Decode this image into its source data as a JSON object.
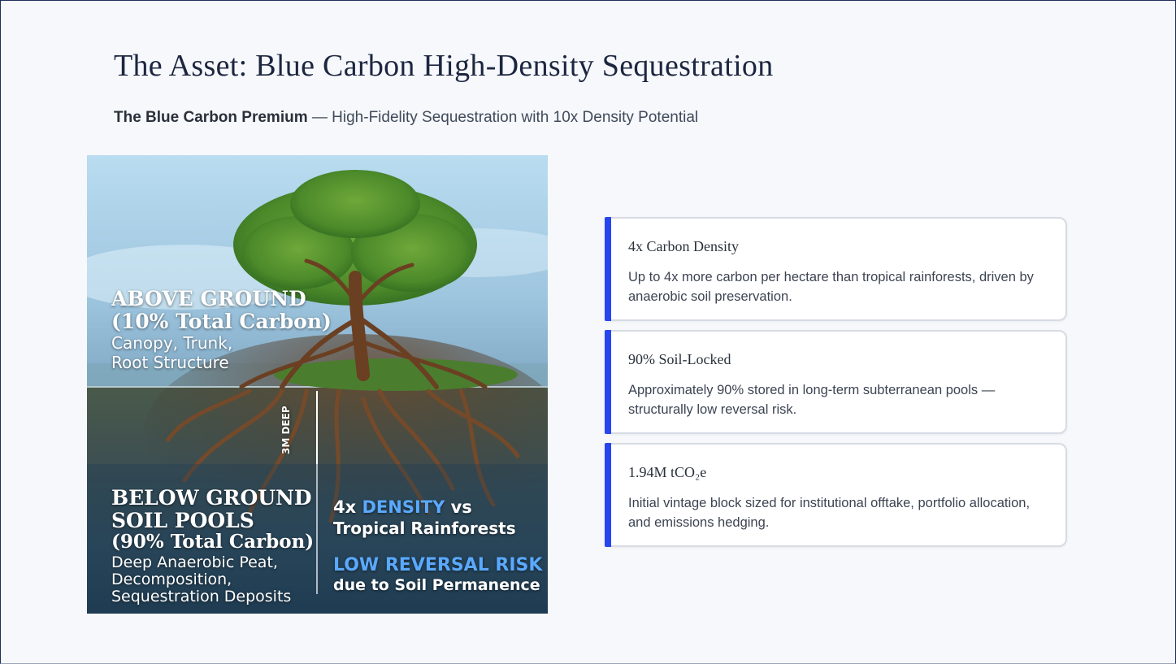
{
  "header": {
    "title": "The Asset: Blue Carbon High-Density Sequestration",
    "subtitle_bold": "The Blue Carbon Premium",
    "subtitle_rest": " — High-Fidelity Sequestration with 10x Density Potential"
  },
  "illustration": {
    "above_line1": "ABOVE GROUND",
    "above_line2": "(10% Total Carbon)",
    "above_line3": "Canopy, Trunk,",
    "above_line4": "Root Structure",
    "depth_label": "3M DEEP",
    "below_line1": "BELOW GROUND",
    "below_line2": "SOIL POOLS",
    "below_line3": "(90% Total Carbon)",
    "below_line4": "Deep Anaerobic Peat,",
    "below_line5": "Decomposition,",
    "below_line6": "Sequestration Deposits",
    "density_prefix": "4x ",
    "density_word": "DENSITY",
    "density_suffix": " vs",
    "density_line2": "Tropical Rainforests",
    "risk_line1": "LOW REVERSAL RISK",
    "risk_line2": "due to Soil Permanence"
  },
  "cards": [
    {
      "title": "4x Carbon Density",
      "body": "Up to 4x more carbon per hectare than tropical rainforests, driven by anaerobic soil preservation."
    },
    {
      "title": "90% Soil-Locked",
      "body": "Approximately 90% stored in long-term subterranean pools — structurally low reversal risk."
    },
    {
      "title": "1.94M tCO₂e",
      "body": "Initial vintage block sized for institutional offtake, portfolio allocation, and emissions hedging."
    }
  ],
  "colors": {
    "accent": "#2747ee",
    "highlight_text": "#5aa9ff",
    "title_text": "#1c2640"
  }
}
